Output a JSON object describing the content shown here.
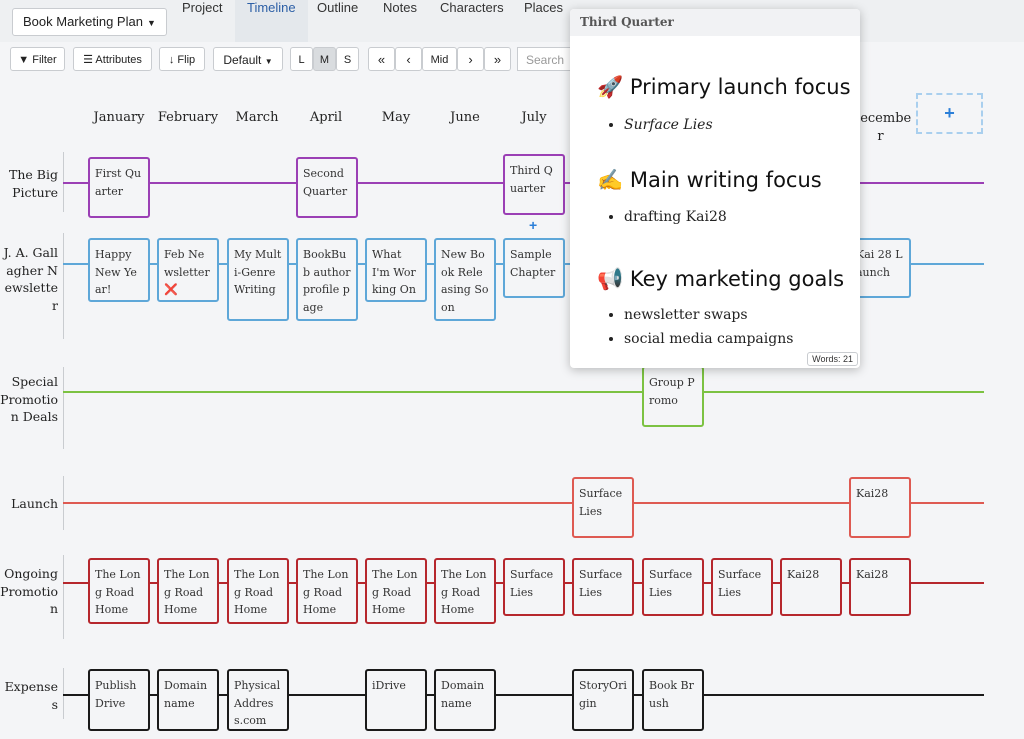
{
  "topbar": {
    "project_menu": "Book Marketing Plan",
    "tabs": [
      "Project",
      "Timeline",
      "Outline",
      "Notes",
      "Characters",
      "Places"
    ],
    "active_tab": "Timeline"
  },
  "toolbar": {
    "filter": "Filter",
    "attributes": "Attributes",
    "flip": "Flip",
    "view": "Default",
    "size_l": "L",
    "size_m": "M",
    "size_s": "S",
    "first": "«",
    "prev": "‹",
    "mid": "Mid",
    "next": "›",
    "last": "»",
    "search_placeholder": "Search"
  },
  "months": [
    "January",
    "February",
    "March",
    "April",
    "May",
    "June",
    "July",
    "December"
  ],
  "add_column": "+",
  "rows": [
    {
      "label": "The Big Picture",
      "color": "#9b3fb5"
    },
    {
      "label": "J. A. Gallagher Newsletter",
      "color": "#5ea7d8"
    },
    {
      "label": "Special Promotion Deals",
      "color": "#7cc242"
    },
    {
      "label": "Launch",
      "color": "#de5a52"
    },
    {
      "label": "Ongoing Promotion",
      "color": "#b6272d"
    },
    {
      "label": "Expenses",
      "color": "#1a1a1a"
    }
  ],
  "cards": {
    "big_picture": [
      "First Quarter",
      "Second Quarter",
      "Third Quarter"
    ],
    "newsletter": [
      "Happy New Year!",
      "Feb Newsletter ❌",
      "My Multi-Genre Writing",
      "BookBub author profile page",
      "What I'm Working On",
      "New Book Releasing Soon",
      "Sample Chapter",
      "Kai 28 Launch"
    ],
    "special": [
      "Group Promo"
    ],
    "launch": [
      "Surface Lies",
      "Kai28"
    ],
    "ongoing": [
      "The Long Road Home",
      "The Long Road Home",
      "The Long Road Home",
      "The Long Road Home",
      "The Long Road Home",
      "The Long Road Home",
      "Surface Lies",
      "Surface Lies",
      "Surface Lies",
      "Surface Lies",
      "Kai28",
      "Kai28"
    ],
    "expenses": [
      "PublishDrive",
      "Domain name",
      "PhysicalAddress.com",
      "iDrive",
      "Domain name",
      "StoryOrigin",
      "Book Brush"
    ]
  },
  "popup": {
    "title": "Third Quarter",
    "sections": [
      {
        "emoji": "🚀",
        "heading": "Primary launch focus",
        "items": [
          "Surface Lies"
        ]
      },
      {
        "emoji": "✍️",
        "heading": "Main writing focus",
        "items": [
          "drafting Kai28"
        ]
      },
      {
        "emoji": "📢",
        "heading": "Key marketing goals",
        "items": [
          "newsletter swaps",
          "social media campaigns"
        ]
      }
    ],
    "words": "Words: 21"
  }
}
